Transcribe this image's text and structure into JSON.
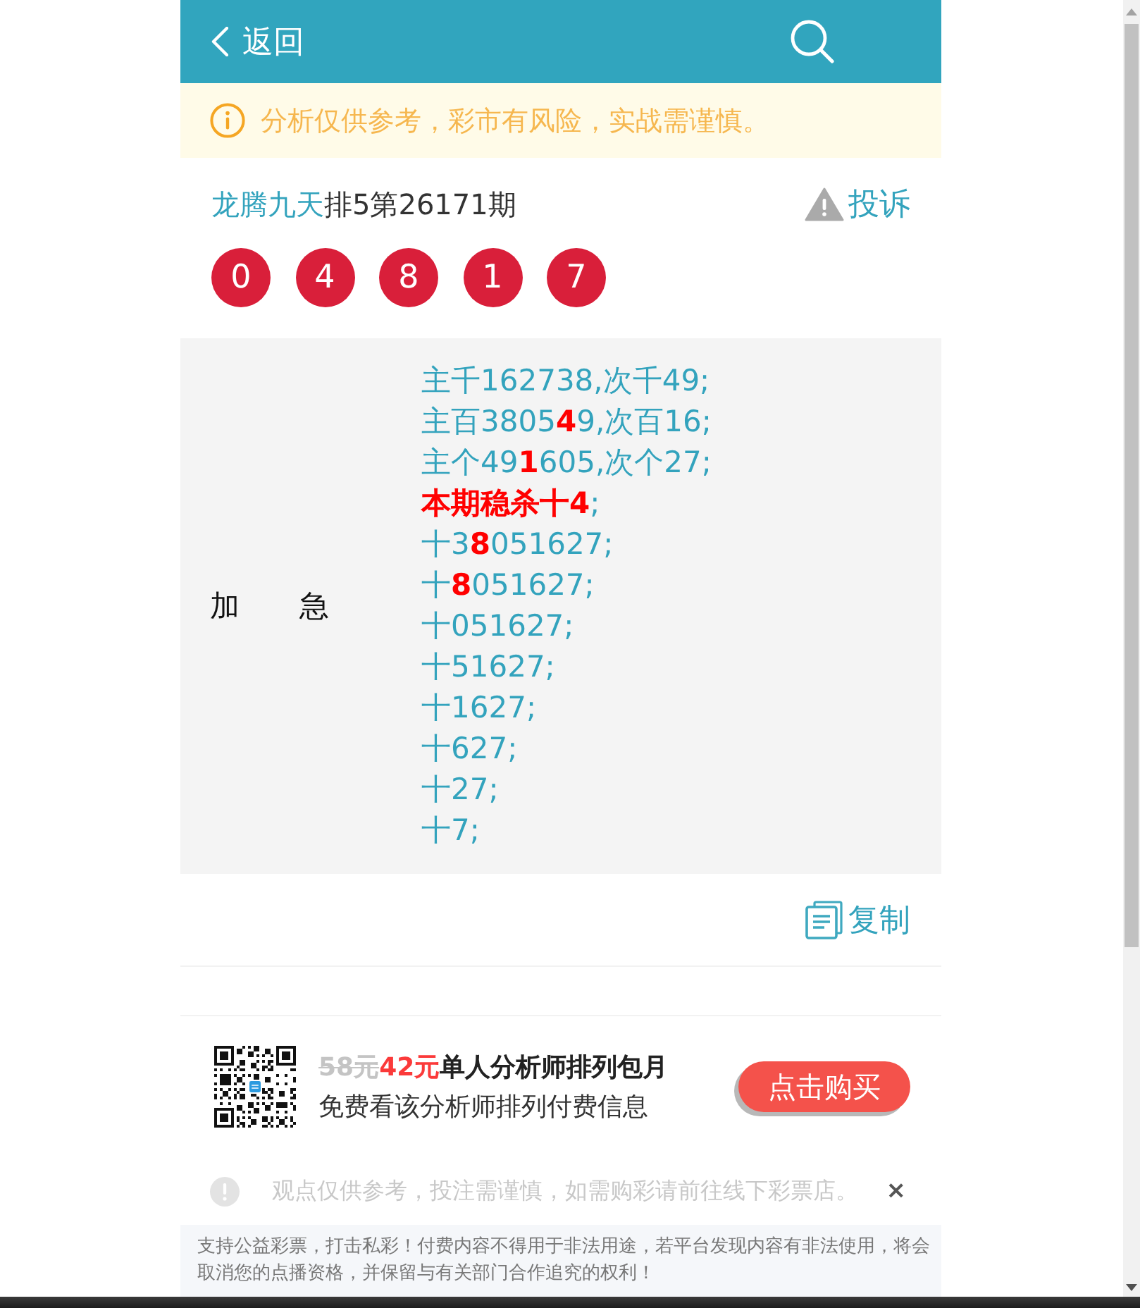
{
  "header": {
    "back_label": "返回"
  },
  "notice": {
    "text": "分析仅供参考，彩市有风险，实战需谨慎。"
  },
  "post": {
    "analyst": "龙腾九天",
    "issue": "排5第26171期",
    "complaint_label": "投诉"
  },
  "draw_numbers": [
    "0",
    "4",
    "8",
    "1",
    "7"
  ],
  "prediction": {
    "label": "加 急",
    "lines": [
      "主千162738,次千49;",
      "主百3805**4**9,次百16;",
      "主个49**1**605,次个27;",
      "**本期稳杀十4**;",
      "十3**8**051627;",
      "十**8**051627;",
      "十051627;",
      "十51627;",
      "十1627;",
      "十627;",
      "十27;",
      "十7;"
    ]
  },
  "copy_label": "复制",
  "promo": {
    "old_price": "58元",
    "price": "42元",
    "title": "单人分析师排列包月",
    "subtitle": "免费看该分析师排列付费信息",
    "button": "点击购买"
  },
  "tip": {
    "text": "观点仅供参考，投注需谨慎，如需购彩请前往线下彩票店。",
    "close": "×"
  },
  "footer_notice": "支持公益彩票，打击私彩！付费内容不得用于非法用途，若平台发现内容有非法使用，将会取消您的点播资格，并保留与有关部门合作追究的权利！"
}
